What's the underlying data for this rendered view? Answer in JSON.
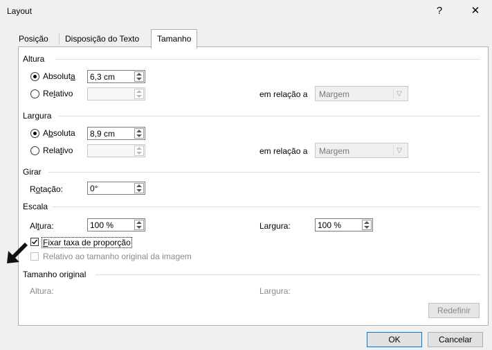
{
  "window": {
    "title": "Layout",
    "help": "?",
    "close": "✕"
  },
  "tabs": [
    "Posição",
    "Disposição do Texto",
    "Tamanho"
  ],
  "altura": {
    "section": "Altura",
    "absoluta_pre": "Absolut",
    "absoluta_u": "a",
    "absoluta_post": "",
    "absoluta_value": "6,3 cm",
    "relativo_pre": "Re",
    "relativo_u": "l",
    "relativo_post": "ativo",
    "relativo_value": "",
    "em_relacao": "em relação a",
    "relacao_value": "Margem"
  },
  "largura": {
    "section": "Largura",
    "absoluta_pre": "A",
    "absoluta_u": "b",
    "absoluta_post": "soluta",
    "absoluta_value": "8,9 cm",
    "relativo_pre": "Rela",
    "relativo_u": "t",
    "relativo_post": "ivo",
    "relativo_value": "",
    "em_relacao": "em relação a",
    "relacao_value": "Margem"
  },
  "girar": {
    "section": "Girar",
    "rotacao_pre": "R",
    "rotacao_u": "o",
    "rotacao_post": "tação:",
    "rotacao_value": "0°"
  },
  "escala": {
    "section": "Escala",
    "altura_pre": "Al",
    "altura_u": "t",
    "altura_post": "ura:",
    "altura_value": "100 %",
    "largura_pre": "Lar",
    "largura_u": "g",
    "largura_post": "ura:",
    "largura_value": "100 %",
    "fixar_u": "F",
    "fixar_post": "ixar taxa de proporção",
    "relativo_original": "Relativo ao tamanho original da imagem"
  },
  "original": {
    "section": "Tamanho original",
    "altura": "Altura:",
    "largura_pre": "Lar",
    "largura_u": "g",
    "largura_post": "ura:"
  },
  "buttons": {
    "redefinir": "Redefinir",
    "ok": "OK",
    "cancelar": "Cancelar"
  }
}
